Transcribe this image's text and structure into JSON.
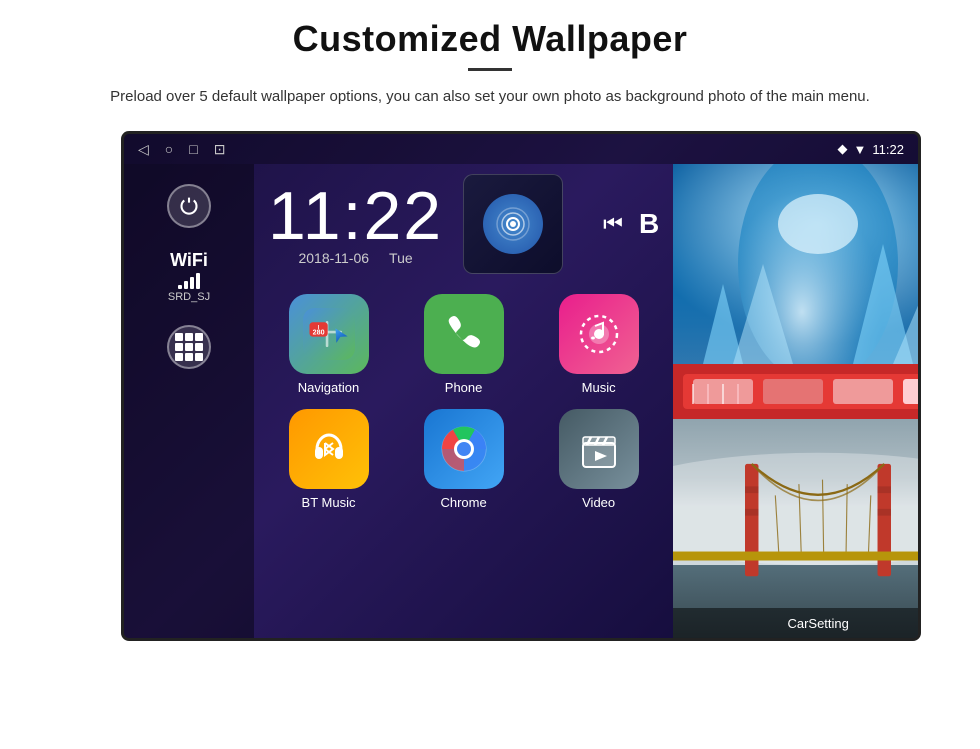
{
  "page": {
    "title": "Customized Wallpaper",
    "description": "Preload over 5 default wallpaper options, you can also set your own photo as background photo of the main menu."
  },
  "device": {
    "status_bar": {
      "time": "11:22",
      "wifi_icon": "▼",
      "location_icon": "◆"
    },
    "clock": {
      "time": "11:22",
      "date": "2018-11-06",
      "day": "Tue"
    },
    "sidebar": {
      "wifi_label": "WiFi",
      "wifi_ssid": "SRD_SJ"
    },
    "apps": [
      {
        "label": "Navigation",
        "icon": "navigation"
      },
      {
        "label": "Phone",
        "icon": "phone"
      },
      {
        "label": "Music",
        "icon": "music"
      },
      {
        "label": "BT Music",
        "icon": "bt-music"
      },
      {
        "label": "Chrome",
        "icon": "chrome"
      },
      {
        "label": "Video",
        "icon": "video"
      }
    ],
    "wallpapers": [
      {
        "label": "Ice Cave",
        "type": "ice"
      },
      {
        "label": "Pink UI",
        "type": "pink"
      },
      {
        "label": "Golden Gate",
        "type": "bridge"
      }
    ],
    "carsetting_label": "CarSetting"
  }
}
